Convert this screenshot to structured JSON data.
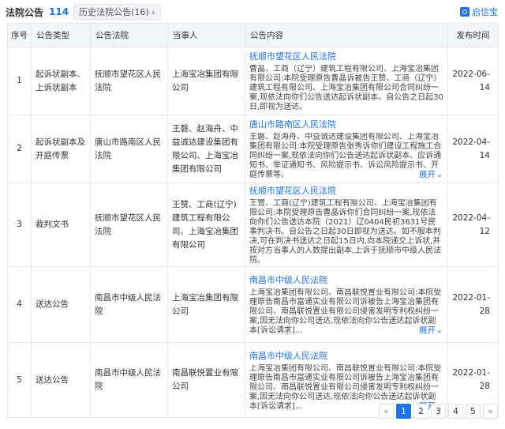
{
  "header": {
    "title": "法院公告",
    "count": "114",
    "history_label": "历史法院公告(16)",
    "history_arrow": "›",
    "brand": "启信宝"
  },
  "columns": [
    "序号",
    "公告类型",
    "公告法院",
    "当事人",
    "公告内容",
    "发布时间"
  ],
  "rows": [
    {
      "index": "1",
      "type": "起诉状副本、上诉状副本",
      "court": "抚顺市望花区人民法院",
      "parties": "上海宝冶集团有限公司",
      "content_court": "抚顺市望花区人民法院",
      "summary": "曹晶、工商（辽宁）建筑工程有限公司、上海宝冶集团有限公司:本院受理原告曹晶诉被告王赞、工商（辽宁）建筑工程有限公司、上海宝冶集团有限公司合同纠纷一案,现依法向你们公告送达起诉状副本。自公告之日起30日,即视为送达。",
      "expand": "",
      "date": "2022-06-14"
    },
    {
      "index": "2",
      "type": "起诉状副本及开庭传票",
      "court": "唐山市路南区人民法院",
      "parties": "王磐、赵海舟、中益诚达建设集团有限公司、上海宝冶集团有限公司",
      "content_court": "唐山市路南区人民法院",
      "summary": "王磐、赵海舟、中益诚达建设集团有限公司、上海宝冶集团有限公司:本院受理原告张秀诉你们建设工程施工合同纠纷一案,现依法向你们公告送达起诉状副本、应诉通知书、举证通知书、风险提示书、诉讼风险提示书、开庭传票等。",
      "expand": "展开",
      "date": "2022-04-14"
    },
    {
      "index": "3",
      "type": "裁判文书",
      "court": "抚顺市望花区人民法院",
      "parties": "王赞、工商(辽宁)建筑工程有限公司、上海宝冶集团有限公司",
      "content_court": "抚顺市望花区人民法院",
      "summary": "王赞、工商(辽宁)建筑工程有限公司、上海宝冶集团有限公司:本院受理原告曹晶诉你们合同纠纷一案,现依法向你们公告送达本院（2021）辽0404民初3631号民事判决书。自公告之日起30日即视为送达。如不服本判决,可在判决书送达之日起15日内,向本院递交上诉状,并按对方当事人的人数提出副本,上诉于抚顺市中级人民法院。",
      "expand": "",
      "date": "2022-04-12"
    },
    {
      "index": "4",
      "type": "送达公告",
      "court": "南昌市中级人民法院",
      "parties": "上海宝冶集团有限公司",
      "content_court": "南昌市中级人民法院",
      "summary": "上海宝冶集团有限公司、南昌联悦置业有限公司:本院受理原告南昌市富通实业有限公司诉被告上海宝冶集团有限公司、南昌联悦置业有限公司侵害发明专利权纠纷一案,因无法向你公司送达,现依法向你公告送达起诉状副本[诉讼请求]...",
      "expand": "展开",
      "date": "2022-01-28"
    },
    {
      "index": "5",
      "type": "送达公告",
      "court": "南昌市中级人民法院",
      "parties": "南昌联悦置业有限公司",
      "content_court": "南昌市中级人民法院",
      "summary": "上海宝冶集团有限公司、南昌联悦置业有限公司:本院受理原告南昌市富通实业有限公司诉被告上海宝冶集团有限公司、南昌联悦置业有限公司侵害发明专利权纠纷一案,因无法向你公司送达,现依法向你公告送达起诉状副本[诉讼请求]...",
      "expand": "展开",
      "date": "2022-01-28"
    }
  ],
  "pagination": {
    "prev": "«",
    "pages": [
      "1",
      "2",
      "3",
      "4",
      "5"
    ],
    "active": "1",
    "next": "»"
  },
  "colors": {
    "accent": "#1e73e6",
    "header_bg": "#f2f5f9",
    "border": "#e4e7ec"
  }
}
